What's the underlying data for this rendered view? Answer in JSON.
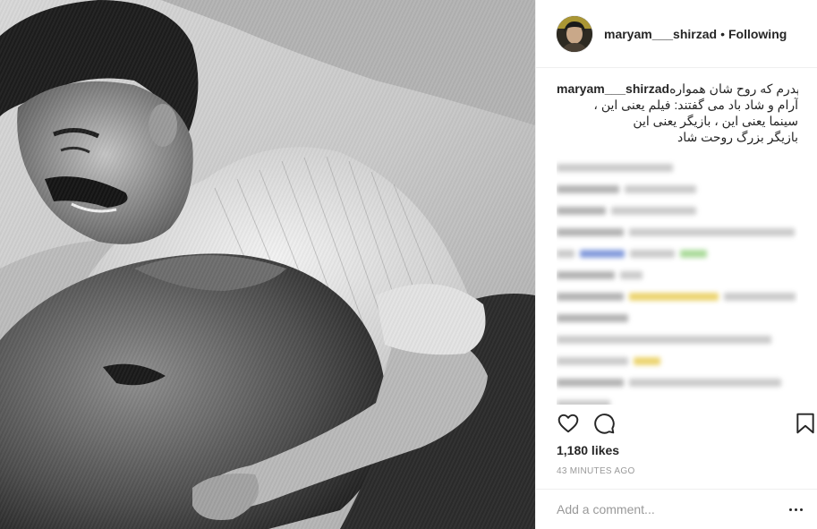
{
  "post": {
    "header": {
      "username": "maryam___shirzad",
      "separator": "•",
      "follow_status": "Following"
    },
    "caption": {
      "username": "maryam___shirzad",
      "line1": "پدرم که روح شان همواره",
      "line2": "آرام و شاد باد می گفتند: فیلم یعنی این ،",
      "line3": "سینما یعنی این ، بازیگر یعنی این",
      "line4": "بازیگر بزرگ روحت شاد"
    },
    "actions": {
      "like_icon": "heart-icon",
      "comment_icon": "comment-bubble-icon",
      "save_icon": "bookmark-icon"
    },
    "likes_text": "1,180 likes",
    "timestamp": "43 MINUTES AGO",
    "comment_input": {
      "placeholder": "Add a comment...",
      "value": ""
    },
    "more_icon": "more-options-icon",
    "colors": {
      "text": "#262626",
      "muted": "#999999",
      "border": "#efefef"
    }
  }
}
